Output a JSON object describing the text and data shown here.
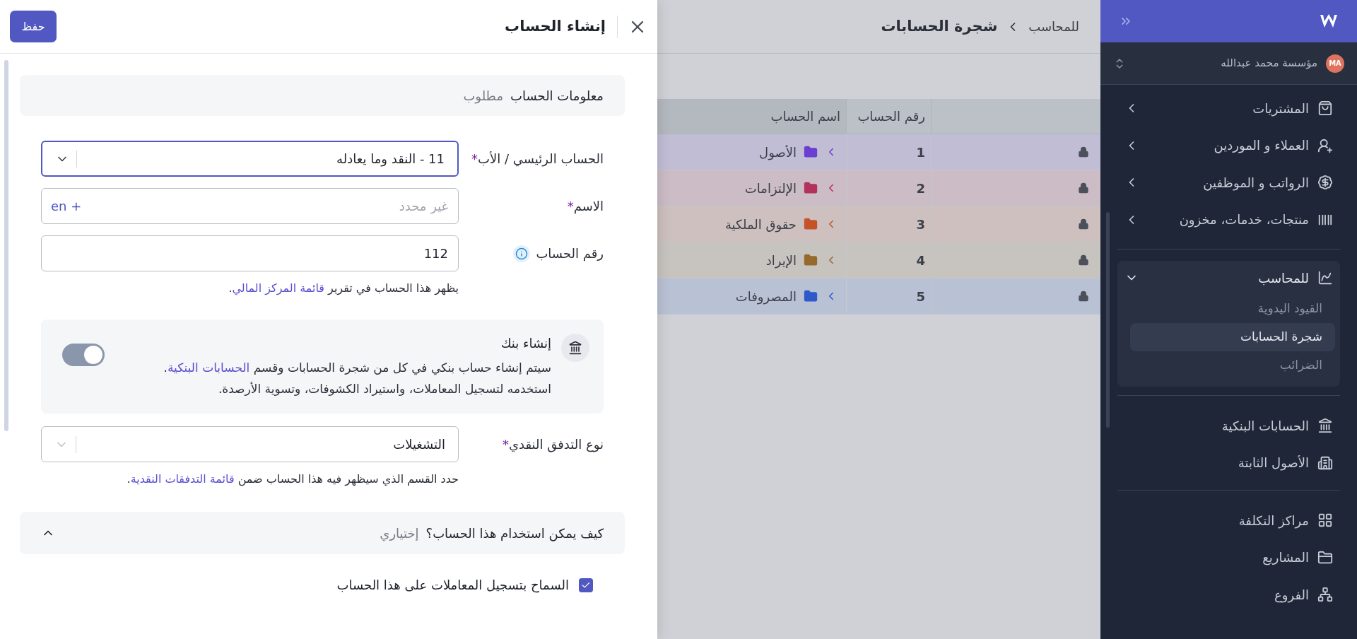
{
  "sidebar": {
    "avatar": "MA",
    "org": "مؤسسة محمد عبدالله",
    "groups": [
      [
        {
          "kind": "menu",
          "label": "المشتريات",
          "expanded": false
        },
        {
          "kind": "menu",
          "label": "العملاء و الموردين",
          "expanded": false
        },
        {
          "kind": "menu",
          "label": "الرواتب و الموظفين",
          "expanded": false
        },
        {
          "kind": "menu",
          "label": "منتجات، خدمات، مخزون",
          "expanded": false
        }
      ],
      [
        {
          "kind": "menu",
          "label": "للمحاسب",
          "expanded": true,
          "children": [
            {
              "label": "القيود اليدوية",
              "selected": false
            },
            {
              "label": "شجرة الحسابات",
              "selected": true
            },
            {
              "label": "الضرائب",
              "selected": false
            }
          ]
        }
      ],
      [
        {
          "kind": "link",
          "label": "الحسابات البنكية"
        },
        {
          "kind": "link",
          "label": "الأصول الثابتة"
        }
      ],
      [
        {
          "kind": "link",
          "label": "مراكز التكلفة"
        },
        {
          "kind": "link",
          "label": "المشاريع"
        },
        {
          "kind": "link",
          "label": "الفروع"
        }
      ]
    ]
  },
  "page": {
    "breadcrumb": "للمحاسب",
    "title": "شجرة الحسابات",
    "table": {
      "columns": [
        "رقم الحساب",
        "اسم الحساب"
      ],
      "rows": [
        {
          "locked": true,
          "number": "1",
          "name": "الأصول",
          "color": "#6b3fd0",
          "expanded": false
        },
        {
          "locked": true,
          "number": "2",
          "name": "الإلتزامات",
          "color": "#b2325c",
          "expanded": false
        },
        {
          "locked": true,
          "number": "3",
          "name": "حقوق الملكية",
          "color": "#c4532a",
          "expanded": false
        },
        {
          "locked": true,
          "number": "4",
          "name": "الإيراد",
          "color": "#96692c",
          "expanded": false
        },
        {
          "locked": true,
          "number": "5",
          "name": "المصروفات",
          "color": "#2f58c9",
          "expanded": false
        }
      ]
    }
  },
  "panel": {
    "title": "إنشاء الحساب",
    "save": "حفظ",
    "section": {
      "title": "معلومات الحساب",
      "badge": "مطلوب"
    },
    "fields": [
      {
        "kind": "select",
        "label": "الحساب الرئيسي / الأب",
        "mark": "*",
        "value": "11 - النقد وما يعادله",
        "focused": true
      },
      {
        "kind": "text",
        "label": "الاسم",
        "mark": "*",
        "placeholder": "غير محدد",
        "addon": "en +"
      },
      {
        "kind": "text",
        "label": "رقم الحساب",
        "info": true,
        "value": "112",
        "hint": {
          "before": "يظهر هذا الحساب في تقرير ",
          "link": "قائمة المركز المالي",
          "after": "."
        }
      },
      {
        "kind": "bank",
        "title": "إنشاء بنك",
        "before": "سيتم إنشاء حساب بنكي في كل من شجرة الحسابات وقسم ",
        "link": "الحسابات البنكية",
        "after": ". استخدمه لتسجيل المعاملات، واستيراد الكشوفات، وتسوية الأرصدة.",
        "on": true
      },
      {
        "kind": "select",
        "label": "نوع التدفق النقدي",
        "mark": "*",
        "value": "التشغيلات",
        "focused": false,
        "hint": {
          "before": "حدد القسم الذي سيظهر فيه هذا الحساب ضمن ",
          "link": "قائمة التدفقات النقدية",
          "after": "."
        }
      }
    ],
    "usage": {
      "title": "كيف يمكن استخدام هذا الحساب؟",
      "badge": "إختياري",
      "expanded": true,
      "options": [
        {
          "label": "السماح بتسجيل المعاملات على هذا الحساب",
          "checked": true
        }
      ]
    }
  }
}
